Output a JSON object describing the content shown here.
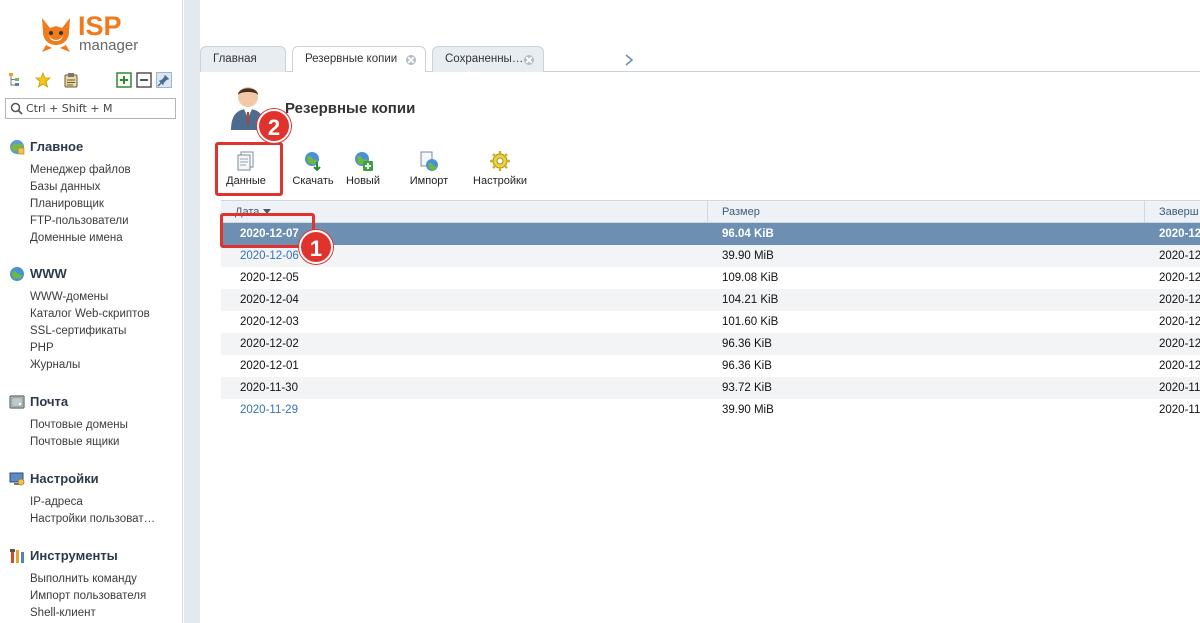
{
  "logo": {
    "brand": "ISP",
    "product": "manager"
  },
  "sidebar": {
    "search_placeholder": "Ctrl + Shift + M",
    "groups": [
      {
        "title": "Главное",
        "icon": "home-globe-icon",
        "items": [
          "Менеджер файлов",
          "Базы данных",
          "Планировщик",
          "FTP-пользователи",
          "Доменные имена"
        ]
      },
      {
        "title": "WWW",
        "icon": "globe-icon",
        "items": [
          "WWW-домены",
          "Каталог Web-скриптов",
          "SSL-сертификаты",
          "PHP",
          "Журналы"
        ]
      },
      {
        "title": "Почта",
        "icon": "mail-icon",
        "items": [
          "Почтовые домены",
          "Почтовые ящики"
        ]
      },
      {
        "title": "Настройки",
        "icon": "settings-monitor-icon",
        "items": [
          "IP-адреса",
          "Настройки пользоват…"
        ]
      },
      {
        "title": "Инструменты",
        "icon": "tools-icon",
        "items": [
          "Выполнить команду",
          "Импорт пользователя",
          "Shell-клиент"
        ]
      }
    ]
  },
  "tabs": [
    {
      "label": "Главная",
      "closable": false,
      "active": false
    },
    {
      "label": "Резервные копии",
      "closable": true,
      "active": true
    },
    {
      "label": "Сохраненны…",
      "closable": true,
      "active": false
    }
  ],
  "page": {
    "title": "Резервные копии"
  },
  "toolbar": {
    "buttons": [
      {
        "label": "Данные",
        "icon": "data-files-icon"
      },
      {
        "label": "Скачать",
        "icon": "download-globe-icon"
      },
      {
        "label": "Новый",
        "icon": "new-add-icon"
      },
      {
        "label": "Импорт",
        "icon": "import-icon"
      },
      {
        "label": "Настройки",
        "icon": "settings-gear-icon"
      }
    ]
  },
  "table": {
    "columns": [
      "Дата",
      "Размер",
      "Заверш"
    ],
    "rows": [
      {
        "date": "2020-12-07",
        "size": "96.04 KiB",
        "done": "2020-12",
        "selected": true,
        "link": false
      },
      {
        "date": "2020-12-06",
        "size": "39.90 MiB",
        "done": "2020-12",
        "selected": false,
        "link": true
      },
      {
        "date": "2020-12-05",
        "size": "109.08 KiB",
        "done": "2020-12",
        "selected": false,
        "link": false
      },
      {
        "date": "2020-12-04",
        "size": "104.21 KiB",
        "done": "2020-12",
        "selected": false,
        "link": false
      },
      {
        "date": "2020-12-03",
        "size": "101.60 KiB",
        "done": "2020-12",
        "selected": false,
        "link": false
      },
      {
        "date": "2020-12-02",
        "size": "96.36 KiB",
        "done": "2020-12",
        "selected": false,
        "link": false
      },
      {
        "date": "2020-12-01",
        "size": "96.36 KiB",
        "done": "2020-12",
        "selected": false,
        "link": false
      },
      {
        "date": "2020-11-30",
        "size": "93.72 KiB",
        "done": "2020-11",
        "selected": false,
        "link": false
      },
      {
        "date": "2020-11-29",
        "size": "39.90 MiB",
        "done": "2020-11",
        "selected": false,
        "link": true
      }
    ]
  },
  "annotations": {
    "badge_1": "1",
    "badge_2": "2"
  },
  "colors": {
    "accent": "#f07b1c",
    "selected_row": "#6d8fb1",
    "link": "#3573b8",
    "annotation": "#e0332e"
  }
}
